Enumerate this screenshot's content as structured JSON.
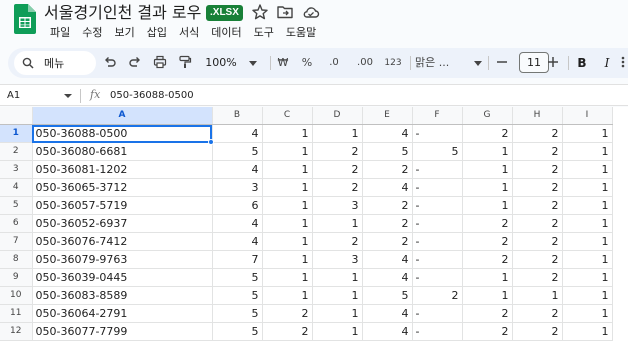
{
  "document": {
    "title": "서울경기인천 결과 로우",
    "file_badge": ".XLSX"
  },
  "menu": [
    "파일",
    "수정",
    "보기",
    "삽입",
    "서식",
    "데이터",
    "도구",
    "도움말"
  ],
  "toolbar": {
    "search_label": "메뉴",
    "zoom": "100%",
    "currency": "₩",
    "percent": "%",
    "decimal_decrease": ".0",
    "decimal_increase": ".00",
    "number_format": "123",
    "font": "맑은 ...",
    "font_size": "11",
    "bold": "B",
    "italic": "I"
  },
  "formula_bar": {
    "cell_ref": "A1",
    "fx": "fx",
    "content": "050-36088-0500"
  },
  "grid": {
    "columns": [
      "A",
      "B",
      "C",
      "D",
      "E",
      "F",
      "G",
      "H",
      "I"
    ],
    "selected_column": "A",
    "selected_row": "1",
    "rows": [
      {
        "n": "1",
        "cells": [
          "050-36088-0500",
          "4",
          "1",
          "1",
          "4",
          "-",
          "2",
          "2",
          "1"
        ]
      },
      {
        "n": "2",
        "cells": [
          "050-36080-6681",
          "5",
          "1",
          "2",
          "5",
          "5",
          "1",
          "2",
          "1"
        ]
      },
      {
        "n": "3",
        "cells": [
          "050-36081-1202",
          "4",
          "1",
          "2",
          "2",
          "-",
          "1",
          "2",
          "1"
        ]
      },
      {
        "n": "4",
        "cells": [
          "050-36065-3712",
          "3",
          "1",
          "2",
          "4",
          "-",
          "1",
          "2",
          "1"
        ]
      },
      {
        "n": "5",
        "cells": [
          "050-36057-5719",
          "6",
          "1",
          "3",
          "2",
          "-",
          "1",
          "2",
          "1"
        ]
      },
      {
        "n": "6",
        "cells": [
          "050-36052-6937",
          "4",
          "1",
          "1",
          "2",
          "-",
          "2",
          "2",
          "1"
        ]
      },
      {
        "n": "7",
        "cells": [
          "050-36076-7412",
          "4",
          "1",
          "2",
          "2",
          "-",
          "2",
          "2",
          "1"
        ]
      },
      {
        "n": "8",
        "cells": [
          "050-36079-9763",
          "7",
          "1",
          "3",
          "4",
          "-",
          "2",
          "2",
          "1"
        ]
      },
      {
        "n": "9",
        "cells": [
          "050-36039-0445",
          "5",
          "1",
          "1",
          "4",
          "-",
          "1",
          "2",
          "1"
        ]
      },
      {
        "n": "10",
        "cells": [
          "050-36083-8589",
          "5",
          "1",
          "1",
          "5",
          "2",
          "1",
          "1",
          "1"
        ]
      },
      {
        "n": "11",
        "cells": [
          "050-36064-2791",
          "5",
          "2",
          "1",
          "4",
          "-",
          "2",
          "2",
          "1"
        ]
      },
      {
        "n": "12",
        "cells": [
          "050-36077-7799",
          "5",
          "2",
          "1",
          "4",
          "-",
          "2",
          "2",
          "1"
        ]
      }
    ]
  },
  "colors": {
    "accent": "#1a73e8",
    "sheets_green": "#188038",
    "selected_header": "#d3e3fd"
  }
}
